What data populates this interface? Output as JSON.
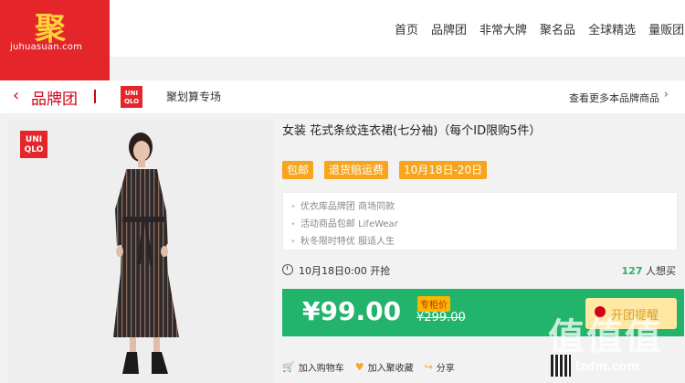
{
  "header": {
    "logo_glyph": "聚",
    "logo_domain": "juhuasuan.com",
    "nav": [
      "首页",
      "品牌团",
      "非常大牌",
      "聚名品",
      "全球精选",
      "量贩团"
    ]
  },
  "subheader": {
    "back_glyph": "‹",
    "title": "品牌团",
    "brand_logo_top": "UNI",
    "brand_logo_bottom": "QLO",
    "subtitle": "聚划算专场",
    "more_link": "查看更多本品牌商品",
    "more_arrow": "›"
  },
  "product": {
    "image_logo_top": "UNI",
    "image_logo_bottom": "QLO",
    "title": "女装 花式条纹连衣裙(七分袖)（每个ID限购5件）",
    "tags": [
      "包邮",
      "退货赔运费",
      "10月18日-20日"
    ],
    "info": [
      "优衣库品牌团 商场同款",
      "活动商品包邮 LifeWear",
      "秋冬限时特优 服适人生"
    ],
    "start_time": "10月18日0:00 开抢",
    "want_count": "127",
    "want_label": "人想买",
    "price": "¥99.00",
    "price_badge": "专柜价",
    "old_price": "¥299.00",
    "buy_button": "开团提醒"
  },
  "actions": [
    {
      "icon": "cart-icon",
      "label": "加入购物车"
    },
    {
      "icon": "heart-icon",
      "label": "加入聚收藏"
    },
    {
      "icon": "share-icon",
      "label": "分享"
    }
  ],
  "watermark": {
    "text": "值值值",
    "site": "izdm.com"
  },
  "colors": {
    "accent_red": "#e4262b",
    "price_green": "#23b46b",
    "tag_orange": "#f7a51d"
  }
}
